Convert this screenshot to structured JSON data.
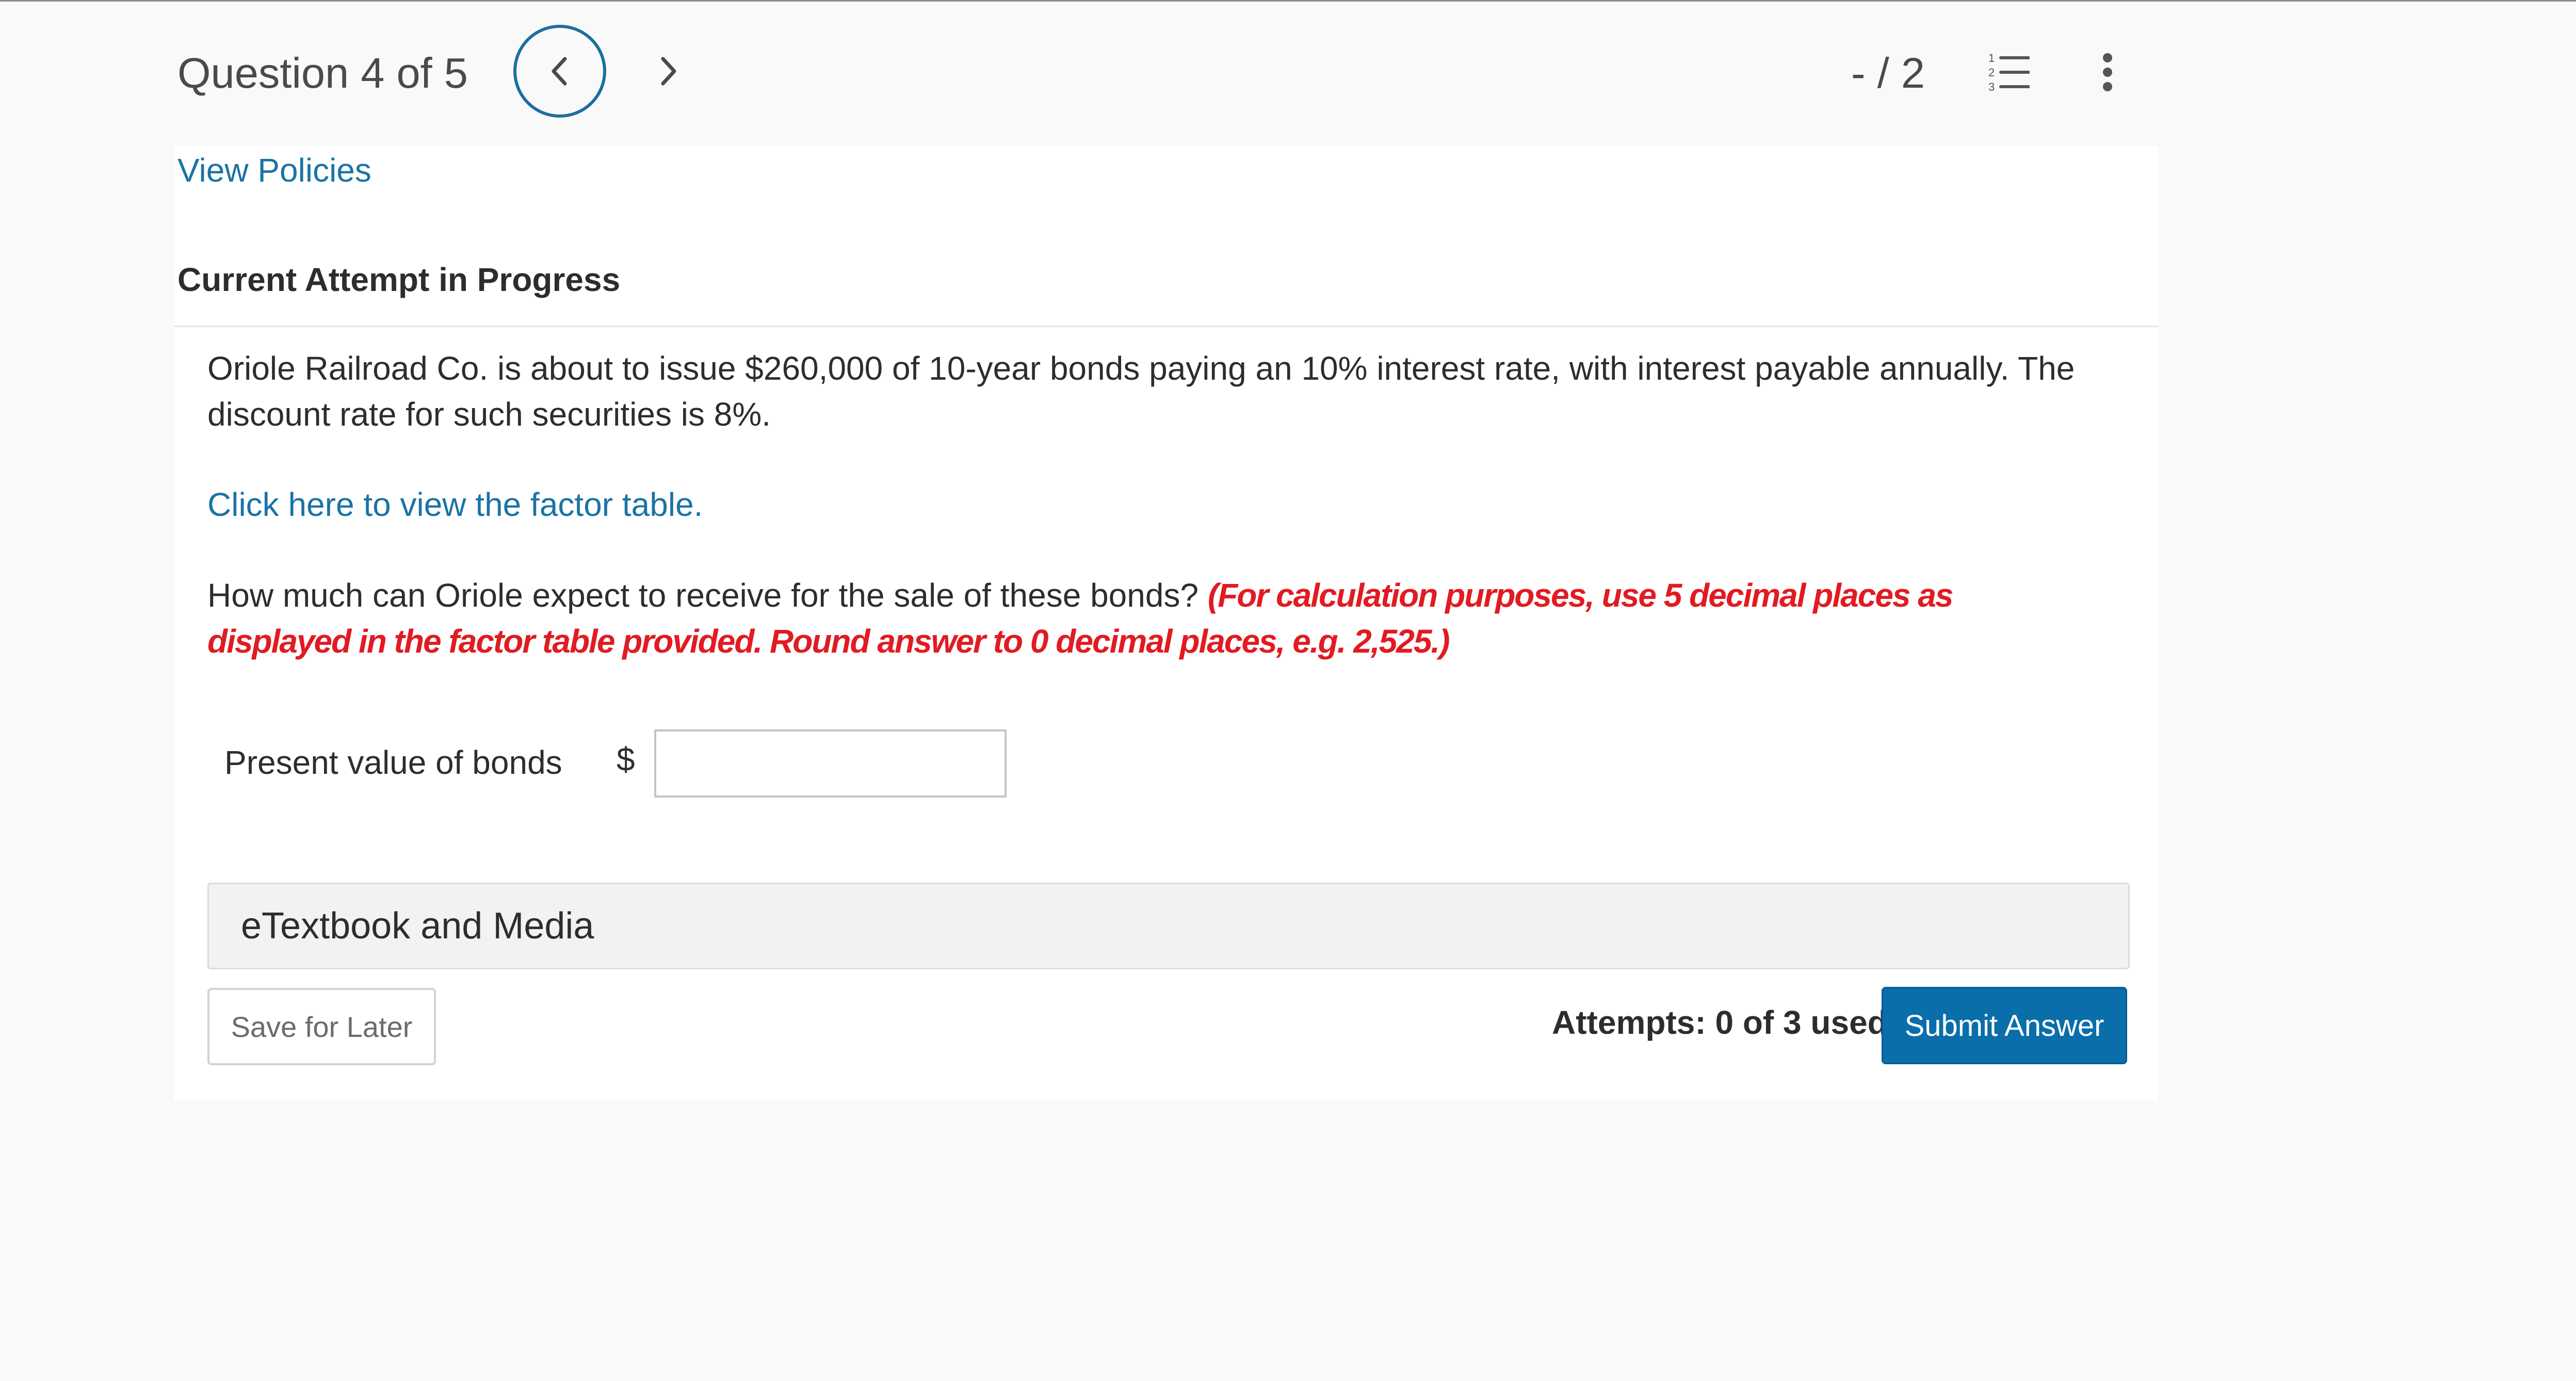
{
  "header": {
    "question_counter": "Question 4 of 5",
    "score": "- / 2",
    "prev_icon": "chevron-left-icon",
    "next_icon": "chevron-right-icon",
    "list_icon": "numbered-list-icon",
    "more_icon": "vertical-ellipsis-icon"
  },
  "links": {
    "view_policies": "View Policies",
    "factor_table": "Click here to view the factor table."
  },
  "attempt": {
    "heading": "Current Attempt in Progress"
  },
  "question": {
    "text": "Oriole Railroad Co. is about to issue $260,000 of 10-year bonds paying an 10% interest rate, with interest payable annually. The discount rate for such securities is 8%.",
    "prompt": "How much can Oriole expect to receive for the sale of these bonds?",
    "instructions": "(For calculation purposes, use 5 decimal places as displayed in the factor table provided. Round answer to 0 decimal places, e.g. 2,525.)"
  },
  "answer": {
    "label": "Present value of bonds",
    "currency": "$",
    "value": "",
    "placeholder": ""
  },
  "etextbook": {
    "label": "eTextbook and Media"
  },
  "footer": {
    "save_label": "Save for Later",
    "attempts": "Attempts: 0 of 3 used",
    "submit_label": "Submit Answer"
  },
  "colors": {
    "link": "#1a73a6",
    "instruction_red": "#e11b22",
    "submit_bg": "#0a6eaa",
    "nav_circle": "#1b6f9e"
  }
}
